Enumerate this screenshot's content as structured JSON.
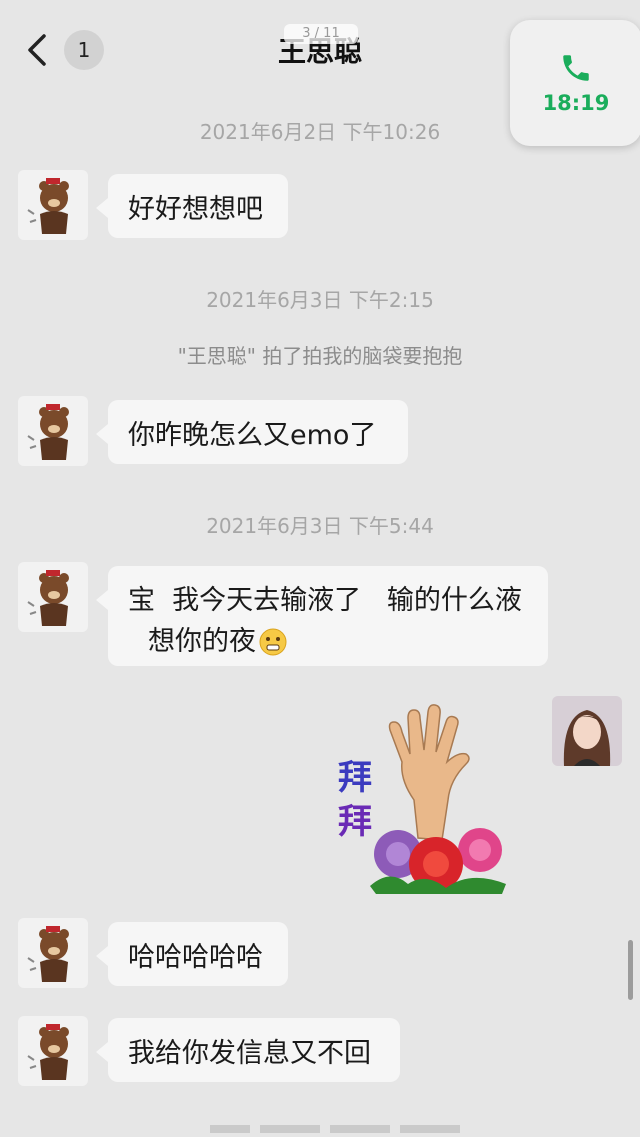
{
  "header": {
    "back_count": "1",
    "title": "王思聪",
    "page_indicator": "3 / 11"
  },
  "call": {
    "time": "18:19",
    "icon": "phone-icon",
    "color": "#1aad5b"
  },
  "timestamps": {
    "t1": "2021年6月2日 下午10:26",
    "t2": "2021年6月3日 下午2:15",
    "t3": "2021年6月3日 下午5:44"
  },
  "system_message": "\"王思聪\" 拍了拍我的脑袋要抱抱",
  "messages": {
    "m1": "好好想想吧",
    "m2": "你昨晚怎么又emo了",
    "m3_line1": "宝  我今天去输液了   输的什么液",
    "m3_line2": "想你的夜",
    "m4": "哈哈哈哈哈",
    "m5": "我给你发信息又不回"
  },
  "sticker": {
    "text1": "拜",
    "text2": "拜",
    "icon": "wave-hand-flowers-sticker"
  },
  "colors": {
    "background": "#e6e6e6",
    "bubble": "#f6f6f6",
    "accent": "#1aad5b"
  }
}
